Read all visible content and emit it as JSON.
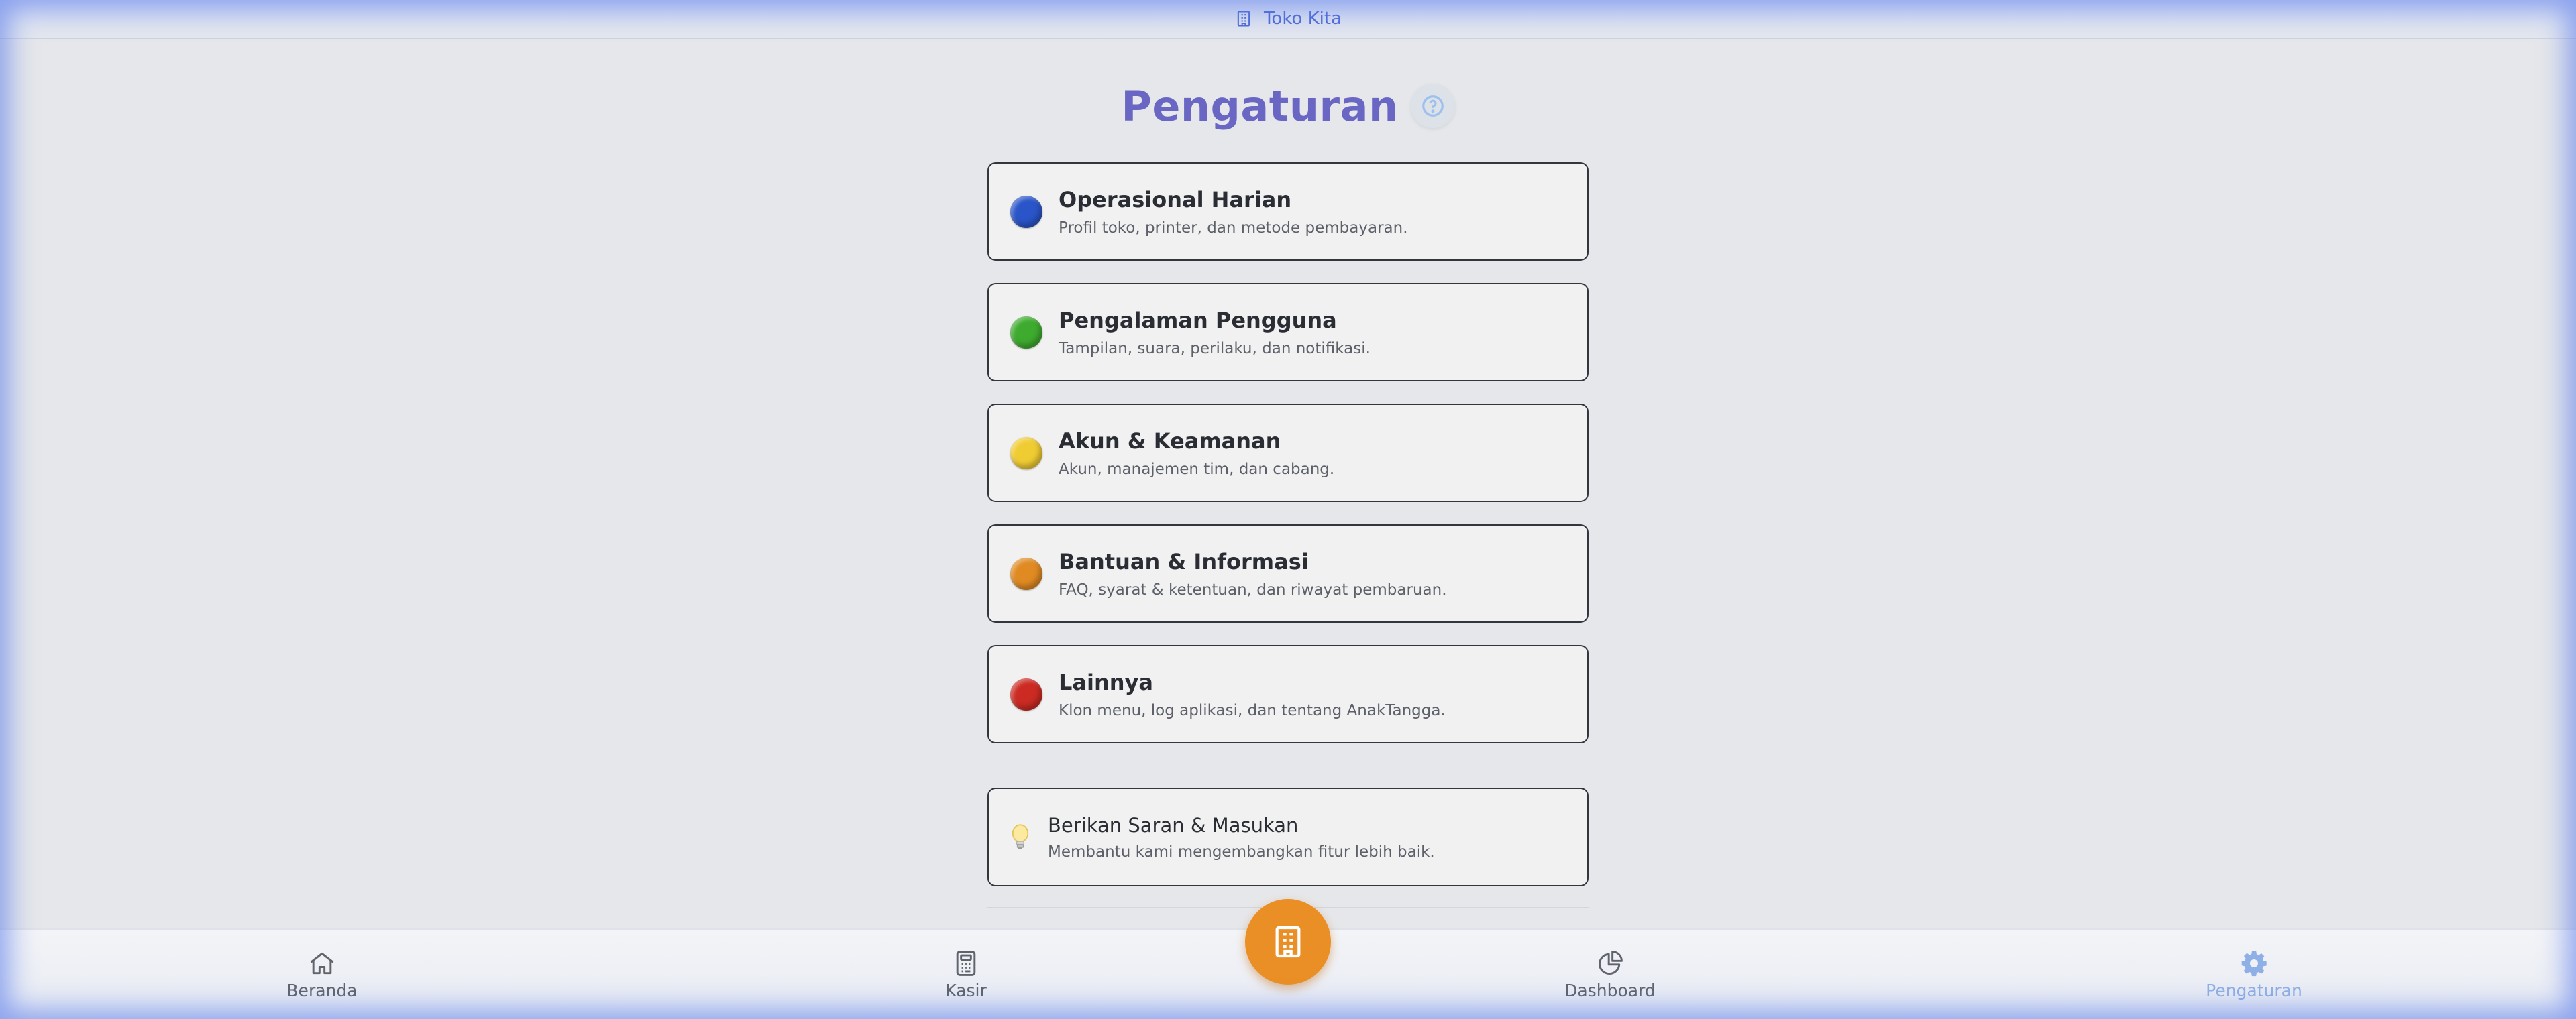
{
  "header": {
    "store_name": "Toko Kita",
    "store_icon": "building-icon"
  },
  "page": {
    "title": "Pengaturan",
    "help_icon": "question-circle-icon"
  },
  "settings": [
    {
      "title": "Operasional Harian",
      "description": "Profil toko, printer, dan metode pembayaran.",
      "color": "#2a55c9"
    },
    {
      "title": "Pengalaman Pengguna",
      "description": "Tampilan, suara, perilaku, dan notifikasi.",
      "color": "#3eab2f"
    },
    {
      "title": "Akun & Keamanan",
      "description": "Akun, manajemen tim, dan cabang.",
      "color": "#f0cc33"
    },
    {
      "title": "Bantuan & Informasi",
      "description": "FAQ, syarat & ketentuan, dan riwayat pembaruan.",
      "color": "#e08a22"
    },
    {
      "title": "Lainnya",
      "description": "Klon menu, log aplikasi, dan tentang AnakTangga.",
      "color": "#cc2b23"
    }
  ],
  "feedback": {
    "title": "Berikan Saran & Masukan",
    "description": "Membantu kami mengembangkan fitur lebih baik.",
    "icon": "lightbulb-icon"
  },
  "nav": {
    "home": "Beranda",
    "cashier": "Kasir",
    "dashboard": "Dashboard",
    "settings": "Pengaturan",
    "center_icon": "building-icon"
  },
  "colors": {
    "accent": "#6a66c4",
    "fab": "#ea8f25",
    "active_nav": "#8fb0e6"
  }
}
